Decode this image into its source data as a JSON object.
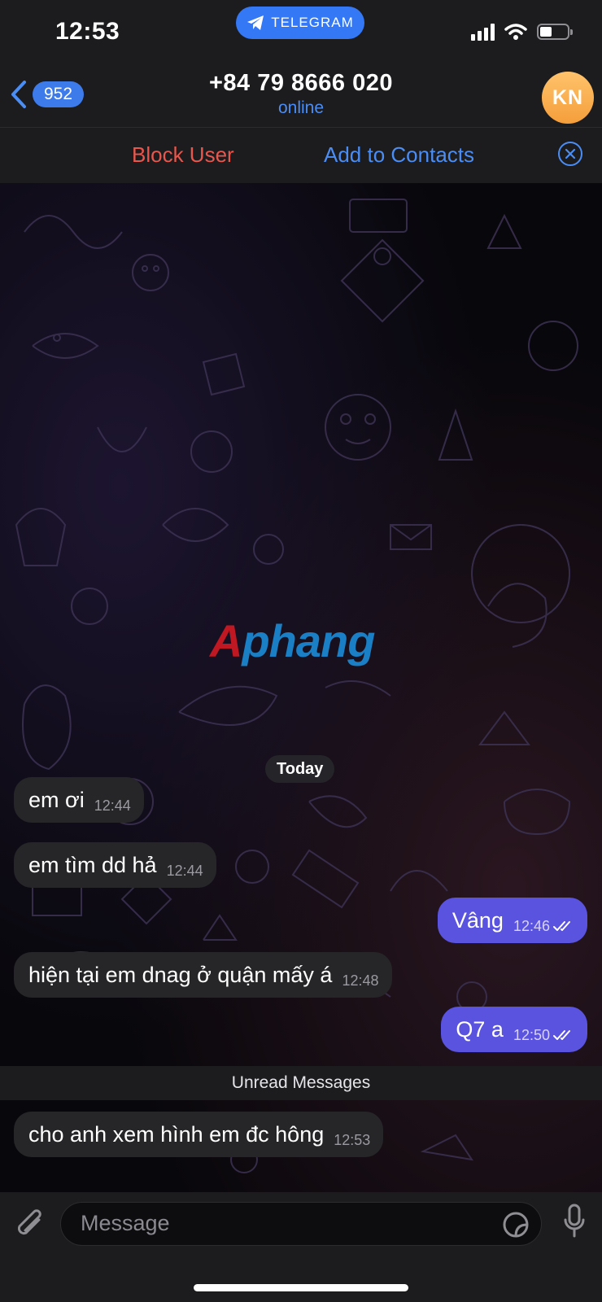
{
  "status_bar": {
    "time": "12:53",
    "app_pill": "TELEGRAM"
  },
  "header": {
    "back_count": "952",
    "title": "+84 79 8666 020",
    "subtitle": "online",
    "avatar_initials": "KN"
  },
  "action_bar": {
    "block_label": "Block User",
    "add_label": "Add to Contacts"
  },
  "watermark": {
    "part1": "A",
    "part2": "phang"
  },
  "chat": {
    "date_label": "Today",
    "messages": [
      {
        "direction": "in",
        "text": "em ơi",
        "time": "12:44"
      },
      {
        "direction": "in",
        "text": "em tìm dd hả",
        "time": "12:44"
      },
      {
        "direction": "out",
        "text": "Vâng",
        "time": "12:46",
        "read": true
      },
      {
        "direction": "in",
        "text": "hiện tại em dnag ở quận mấy á",
        "time": "12:48"
      },
      {
        "direction": "out",
        "text": "Q7 a",
        "time": "12:50",
        "read": true
      },
      {
        "direction": "in",
        "text": "cho anh xem hình em đc hông",
        "time": "12:53"
      }
    ],
    "unread_label": "Unread Messages"
  },
  "input": {
    "placeholder": "Message"
  },
  "colors": {
    "accent": "#4a8df5",
    "outgoing_bubble": "#5a53e0",
    "incoming_bubble": "#262629",
    "danger": "#e8574d"
  },
  "icons": [
    "telegram-plane-icon",
    "signal-icon",
    "wifi-icon",
    "battery-icon",
    "back-chevron-icon",
    "close-circle-icon",
    "read-ticks-icon",
    "paperclip-icon",
    "sticker-icon",
    "microphone-icon"
  ]
}
